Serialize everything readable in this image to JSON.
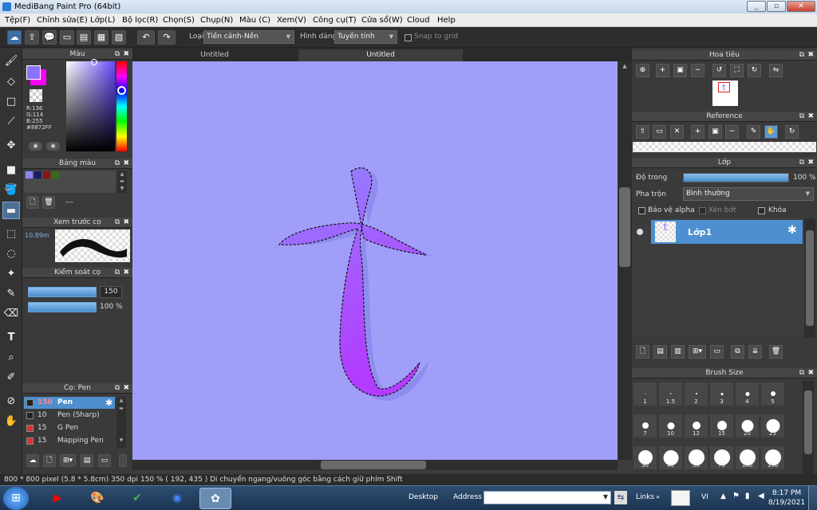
{
  "window": {
    "title": "MediBang Paint Pro (64bit)"
  },
  "menu": [
    "Tệp(F)",
    "Chỉnh sửa(E)",
    "Lớp(L)",
    "Bộ lọc(R)",
    "Chọn(S)",
    "Chụp(N)",
    "Màu (C)",
    "Xem(V)",
    "Công cụ(T)",
    "Cửa sổ(W)",
    "Cloud",
    "Help"
  ],
  "toolbar": {
    "type_label": "Loại",
    "type_value": "Tiền cảnh-Nền",
    "shape_label": "Hình dáng",
    "shape_value": "Tuyến tính",
    "snap_label": "Snap to grid"
  },
  "tabs": [
    "Untitled",
    "Untitled"
  ],
  "color_panel": {
    "title": "Màu",
    "r": "R:136",
    "g": "G:114",
    "b": "B:255",
    "hex": "#8872FF",
    "fg_color": "#8872ff",
    "bg_color": "#ff00ff"
  },
  "palette_panel": {
    "title": "Bảng màu",
    "colors": [
      "#8b86f0",
      "#1c1c6a",
      "#8a1414",
      "#3d6a1a"
    ],
    "placeholder": "---"
  },
  "brush_preview_panel": {
    "title": "Xem trước cọ",
    "size": "10.89m"
  },
  "brush_control_panel": {
    "title": "Kiểm soát cọ",
    "size_value": "150",
    "opacity_value": "100 %"
  },
  "brush_list_panel": {
    "title": "Cọ: Pen",
    "items": [
      {
        "size": "150",
        "name": "Pen",
        "color": "#222222"
      },
      {
        "size": "10",
        "name": "Pen (Sharp)",
        "color": "#222222"
      },
      {
        "size": "15",
        "name": "G Pen",
        "color": "#e03030"
      },
      {
        "size": "15",
        "name": "Mapping Pen",
        "color": "#e03030"
      }
    ]
  },
  "canvas": {
    "bg_color": "#a09ef9",
    "glyph": "t"
  },
  "navigator_panel": {
    "title": "Hoa tiêu",
    "thumb_glyph": "t"
  },
  "reference_panel": {
    "title": "Reference"
  },
  "layer_panel": {
    "title": "Lớp",
    "opacity_label": "Độ trong",
    "opacity_value": "100 %",
    "opacity_fraction": 1.0,
    "blend_label": "Pha trộn",
    "blend_value": "Bình thường",
    "protect_alpha": "Bảo vệ alpha",
    "clipping": "Xén bớt",
    "lock": "Khóa",
    "layers": [
      {
        "name": "Lớp1",
        "thumb_glyph": "t"
      }
    ]
  },
  "brush_size_panel": {
    "title": "Brush Size",
    "sizes": [
      "1",
      "1.5",
      "2",
      "3",
      "4",
      "5",
      "7",
      "10",
      "12",
      "15",
      "20",
      "25",
      "30",
      "40",
      "50",
      "70",
      "100",
      "150"
    ]
  },
  "status": {
    "dims": "800 * 800 pixel",
    "size_cm": "(5.8 * 5.8cm)",
    "dpi": "350 dpi",
    "zoom": "150 %",
    "coords": "( 192, 435 )",
    "hint": "Di chuyển ngang/vuông góc bằng cách giữ phím Shift"
  },
  "taskbar": {
    "desktop_label": "Desktop",
    "address_label": "Address",
    "links_label": "Links",
    "lang": "VI",
    "time": "8:17 PM",
    "date": "8/19/2021"
  }
}
